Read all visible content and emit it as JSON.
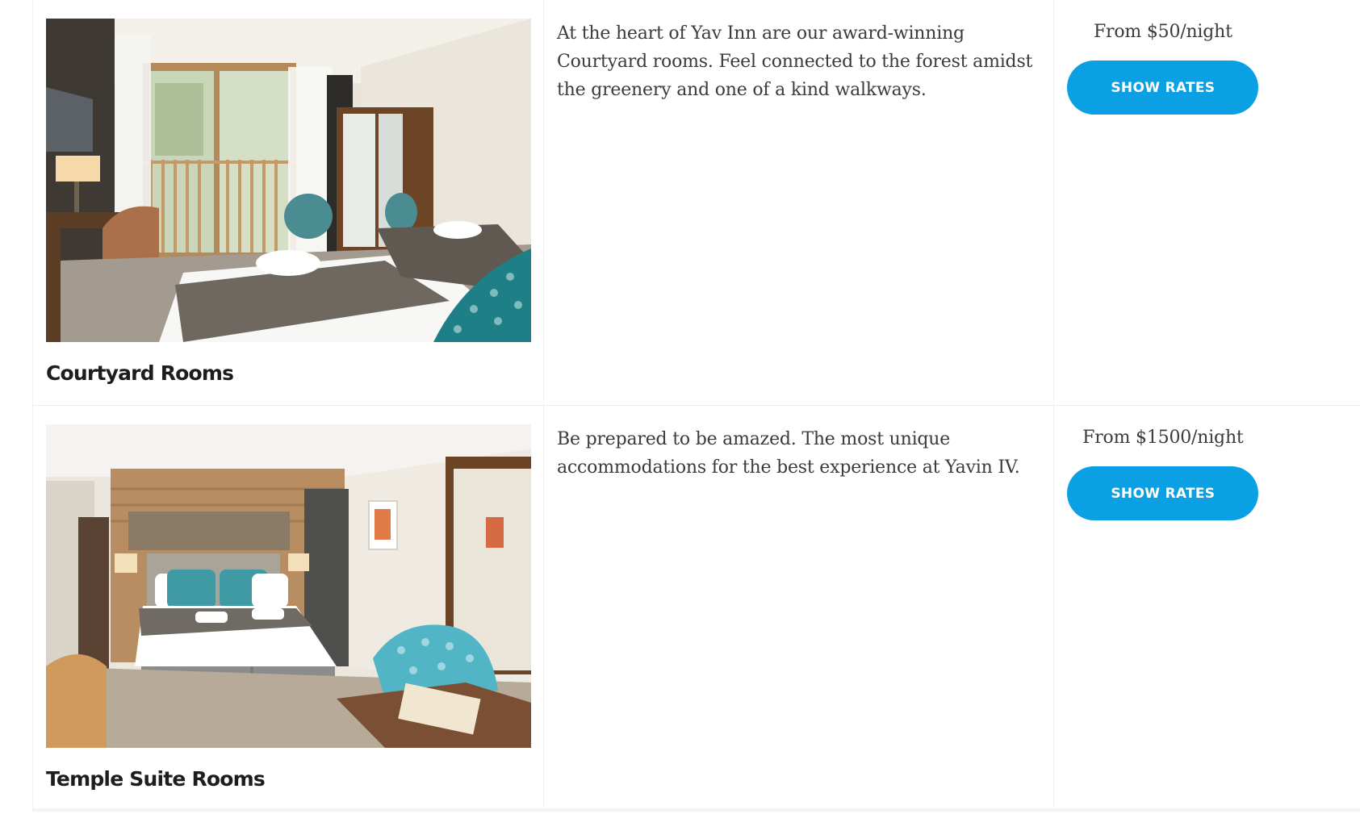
{
  "rooms": [
    {
      "name": "Courtyard Rooms",
      "description": "At the heart of Yav Inn are our award-winning Courtyard rooms. Feel connected to the forest amidst the greenery and one of a kind walkways.",
      "price": "From $50/night",
      "button_label": "SHOW RATES",
      "image_alt": "Courtyard room with two beds, desk and balcony"
    },
    {
      "name": "Temple Suite Rooms",
      "description": "Be prepared to be amazed. The most unique accommodations for the best experience at Yavin IV.",
      "price": "From $1500/night",
      "button_label": "SHOW RATES",
      "image_alt": "Temple suite room with double bed and teal chair"
    }
  ],
  "colors": {
    "accent": "#0aa0e3",
    "title": "#1d1d1d",
    "body_text": "#3b3b3b",
    "divider": "#eeeeee"
  }
}
